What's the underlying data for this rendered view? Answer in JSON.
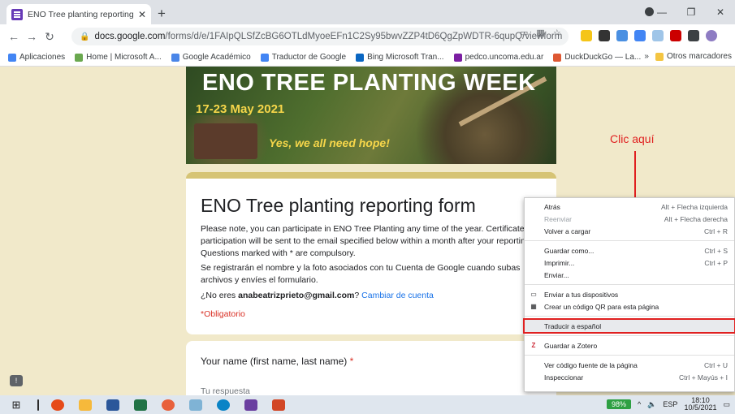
{
  "browser": {
    "tab_title": "ENO Tree planting reporting form",
    "tab_close": "✕",
    "new_tab": "+",
    "url_host": "docs.google.com",
    "url_path": "/forms/d/e/1FAIpQLSfZcBG6OTLdMyoeEFn1C2Sy95bwvZZP4tD6QgZpWDTR-6qupQ/viewform",
    "window_controls": [
      "—",
      "❐",
      "✕"
    ]
  },
  "bookmarks": {
    "items": [
      {
        "label": "Aplicaciones",
        "color": "#4285f4"
      },
      {
        "label": "Home | Microsoft A...",
        "color": "#6aa84f"
      },
      {
        "label": "Google Académico",
        "color": "#4a86e8"
      },
      {
        "label": "Traductor de Google",
        "color": "#4285f4"
      },
      {
        "label": "Bing Microsoft Tran...",
        "color": "#0a66c2"
      },
      {
        "label": "pedco.uncoma.edu.ar",
        "color": "#7b1fa2"
      },
      {
        "label": "DuckDuckGo — La...",
        "color": "#de5833"
      }
    ],
    "more": "»",
    "other": "Otros marcadores"
  },
  "banner": {
    "title": "ENO TREE PLANTING WEEK",
    "dates": "17-23 May 2021",
    "tagline": "Yes, we all need hope!"
  },
  "form": {
    "title": "ENO Tree planting reporting form",
    "description": "Please note, you can participate in ENO Tree Planting any time of the year. Certificates of participation will be sent to the email specified below within a month after your reporting. Questions marked with * are compulsory.",
    "google_notice": "Se registrarán el nombre y la foto asociados con tu Cuenta de Google cuando subas archivos y envíes el formulario.",
    "account_prefix": "¿No eres ",
    "account_email": "anabeatrizprieto@gmail.com",
    "account_suffix": "? ",
    "switch_account": "Cambiar de cuenta",
    "required_note": "*Obligatorio",
    "question_label": "Your name (first name, last name)",
    "question_star": " *",
    "answer_placeholder": "Tu respuesta"
  },
  "context_menu": {
    "items": [
      {
        "label": "Atrás",
        "shortcut": "Alt + Flecha izquierda"
      },
      {
        "label": "Reenviar",
        "shortcut": "Alt + Flecha derecha",
        "disabled": true
      },
      {
        "label": "Volver a cargar",
        "shortcut": "Ctrl + R"
      },
      {
        "label": "Guardar como...",
        "shortcut": "Ctrl + S"
      },
      {
        "label": "Imprimir...",
        "shortcut": "Ctrl + P"
      },
      {
        "label": "Enviar..."
      },
      {
        "label": "Enviar a tus dispositivos"
      },
      {
        "label": "Crear un código QR para esta página"
      },
      {
        "label": "Traducir a español"
      },
      {
        "label": "Guardar a Zotero"
      },
      {
        "label": "Ver código fuente de la página",
        "shortcut": "Ctrl + U"
      },
      {
        "label": "Inspeccionar",
        "shortcut": "Ctrl + Mayús + I"
      }
    ]
  },
  "annotation": {
    "text": "Clic aquí",
    "color": "#e02020"
  },
  "taskbar": {
    "battery": "98%",
    "language": "ESP",
    "time": "18:10",
    "date": "10/5/2021"
  }
}
